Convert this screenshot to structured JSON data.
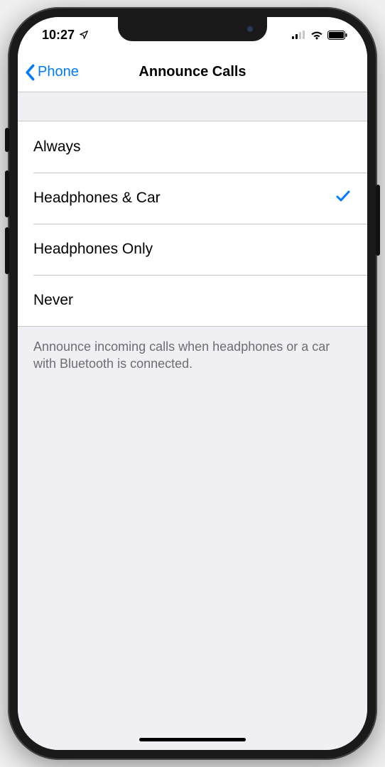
{
  "status": {
    "time": "10:27"
  },
  "nav": {
    "back_label": "Phone",
    "title": "Announce Calls"
  },
  "options": [
    {
      "label": "Always",
      "selected": false
    },
    {
      "label": "Headphones & Car",
      "selected": true
    },
    {
      "label": "Headphones Only",
      "selected": false
    },
    {
      "label": "Never",
      "selected": false
    }
  ],
  "footer": "Announce incoming calls when headphones or a car with Bluetooth is connected."
}
